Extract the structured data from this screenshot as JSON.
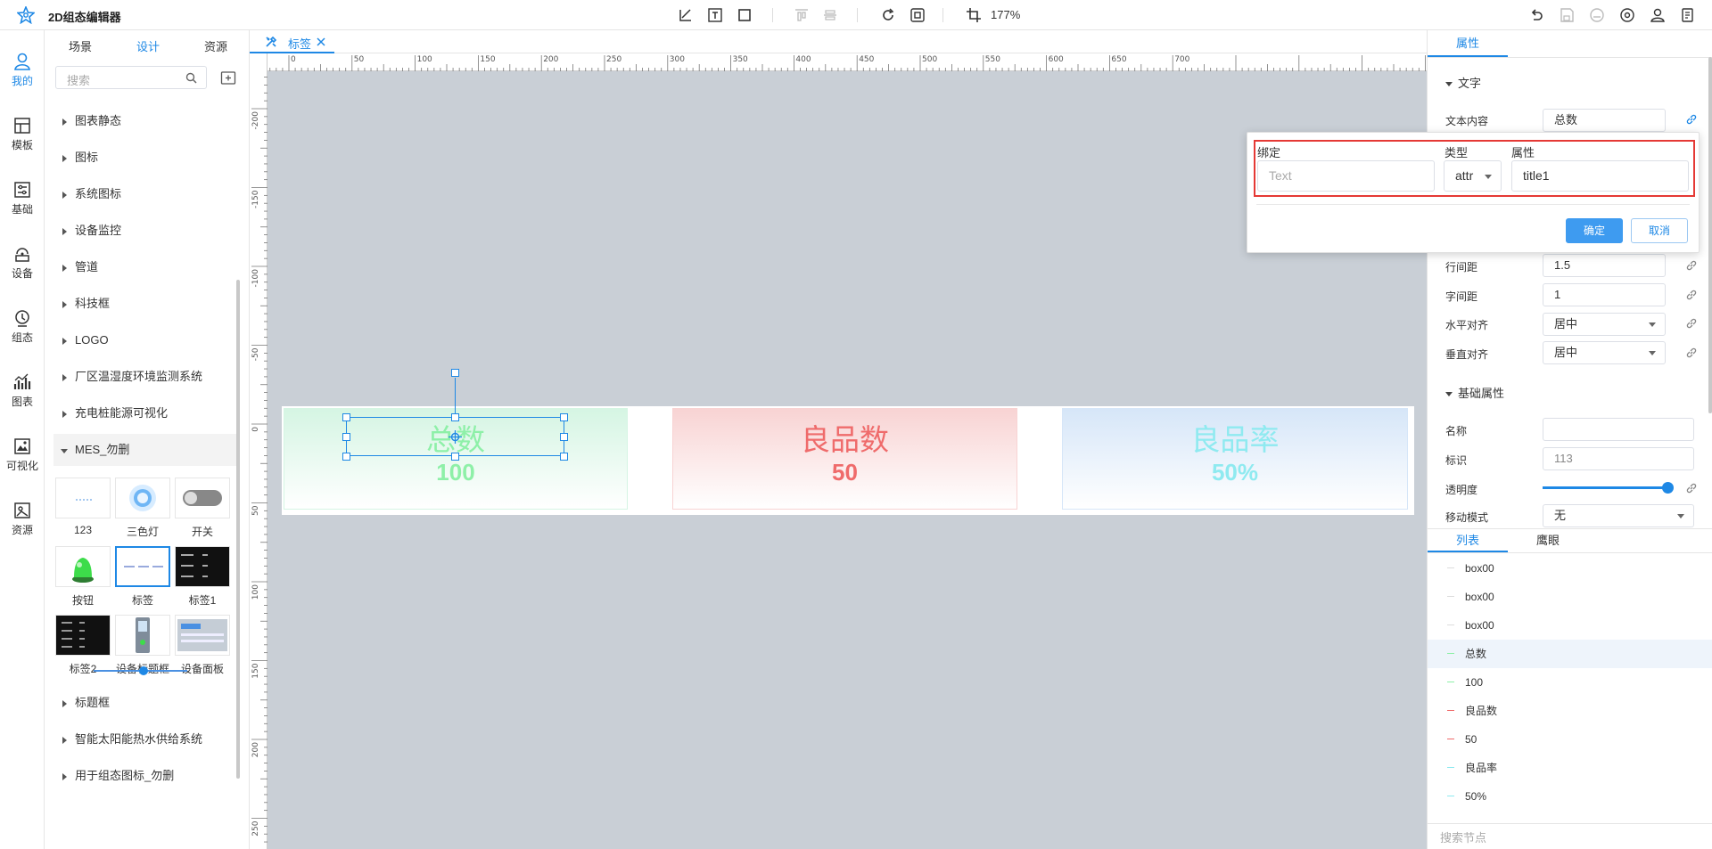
{
  "app": {
    "title": "2D组态编辑器"
  },
  "toolbar": {
    "zoom": "177%"
  },
  "rail": [
    {
      "label": "我的",
      "icon": "user-icon",
      "active": true
    },
    {
      "label": "模板",
      "icon": "template-icon"
    },
    {
      "label": "基础",
      "icon": "basic-icon"
    },
    {
      "label": "设备",
      "icon": "device-icon"
    },
    {
      "label": "组态",
      "icon": "config-icon"
    },
    {
      "label": "图表",
      "icon": "chart-icon"
    },
    {
      "label": "可视化",
      "icon": "visual-icon"
    },
    {
      "label": "资源",
      "icon": "resource-icon"
    }
  ],
  "left_panel": {
    "tabs": [
      "场景",
      "设计",
      "资源"
    ],
    "active_tab": 1,
    "search_placeholder": "搜索",
    "tree": [
      "图表静态",
      "图标",
      "系统图标",
      "设备监控",
      "管道",
      "科技框",
      "LOGO",
      "厂区温湿度环境监测系统",
      "充电桩能源可视化",
      "MES_勿删"
    ],
    "tree_after": [
      "标题框",
      "智能太阳能热水供给系统",
      "用于组态图标_勿删"
    ],
    "tiles": [
      "123",
      "三色灯",
      "开关",
      "按钮",
      "标签",
      "标签1",
      "标签2",
      "设备标题框",
      "设备面板"
    ]
  },
  "doc_tab": {
    "label": "标签"
  },
  "canvas": {
    "ruler_h": [
      "0",
      "50",
      "100",
      "150",
      "200",
      "250",
      "300",
      "350",
      "400",
      "450",
      "500",
      "550",
      "600",
      "650",
      "700"
    ],
    "ruler_v": [
      "-200",
      "-150",
      "-100",
      "-50",
      "0",
      "50",
      "100",
      "150",
      "200",
      "250"
    ],
    "cards": [
      {
        "title": "总数",
        "value": "100",
        "color": "#8ef0a8",
        "bg_top": "#d5f5e3"
      },
      {
        "title": "良品数",
        "value": "50",
        "color": "#ef6b6b",
        "bg_top": "#f8d3d3"
      },
      {
        "title": "良品率",
        "value": "50%",
        "color": "#8feaf0",
        "bg_top": "#d6e6f8"
      }
    ]
  },
  "right_panel": {
    "tab": "属性",
    "section_text": "文字",
    "text_content_label": "文本内容",
    "text_content_value": "总数",
    "line_height_label": "行间距",
    "line_height_value": "1.5",
    "letter_spacing_label": "字间距",
    "letter_spacing_value": "1",
    "h_align_label": "水平对齐",
    "h_align_value": "居中",
    "v_align_label": "垂直对齐",
    "v_align_value": "居中",
    "section_basic": "基础属性",
    "name_label": "名称",
    "name_value": "",
    "id_label": "标识",
    "id_value": "113",
    "opacity_label": "透明度",
    "opacity": 1.0,
    "move_label": "移动模式",
    "move_value": "无",
    "bottom_tabs": [
      "列表",
      "鹰眼"
    ],
    "nodes": [
      {
        "label": "box00",
        "color": "#ddd"
      },
      {
        "label": "box00",
        "color": "#ddd"
      },
      {
        "label": "box00",
        "color": "#ddd"
      },
      {
        "label": "总数",
        "color": "#8ef0a8",
        "selected": true
      },
      {
        "label": "100",
        "color": "#8ef0a8"
      },
      {
        "label": "良品数",
        "color": "#ef6b6b"
      },
      {
        "label": "50",
        "color": "#ef6b6b"
      },
      {
        "label": "良品率",
        "color": "#8feaf0"
      },
      {
        "label": "50%",
        "color": "#8feaf0"
      }
    ],
    "node_search_placeholder": "搜索节点"
  },
  "popup": {
    "bind_label": "绑定",
    "bind_placeholder": "Text",
    "type_label": "类型",
    "type_value": "attr",
    "attr_label": "属性",
    "attr_value": "title1",
    "confirm": "确定",
    "cancel": "取消"
  },
  "colors": {
    "accent": "#1e88e5",
    "highlight": "#e53935",
    "canvas_bg": "#c9cfd6"
  }
}
